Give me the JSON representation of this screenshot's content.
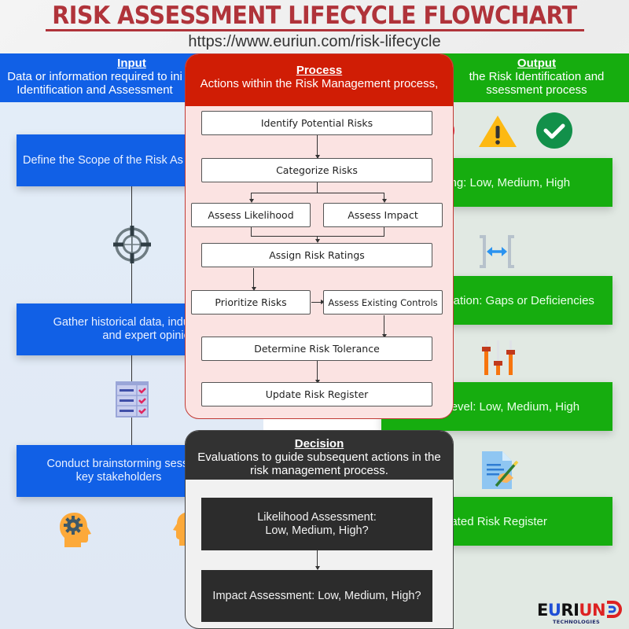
{
  "header": {
    "title": "RISK ASSESSMENT LIFECYCLE FLOWCHART",
    "url": "https://www.euriun.com/risk-lifecycle"
  },
  "input": {
    "heading": "Input",
    "description_line1": "Data or information required to ini",
    "description_line2": "Identification and Assessment",
    "steps": [
      {
        "line1": "Define the Scope of the Risk As",
        "line2": ""
      },
      {
        "line1": "Gather historical data, industr",
        "line2": "and expert opinions"
      },
      {
        "line1": "Conduct brainstorming sessi",
        "line2": "key stakeholders"
      }
    ],
    "icons": [
      "target-crosshair-icon",
      "checklist-icon",
      "head-gear-icon"
    ]
  },
  "process": {
    "heading": "Process",
    "description": "Actions within the Risk Management process,",
    "steps": {
      "identify": "Identify Potential Risks",
      "categorize": "Categorize Risks",
      "likelihood": "Assess Likelihood",
      "impact": "Assess Impact",
      "assign": "Assign Risk Ratings",
      "prioritize": "Prioritize Risks",
      "controls": "Assess Existing Controls",
      "tolerance": "Determine Risk Tolerance",
      "update": "Update Risk Register"
    }
  },
  "output": {
    "heading": "Output",
    "description_line1": "the Risk Identification and",
    "description_line2": "ssessment process",
    "results": [
      "ting: Low, Medium, High",
      "luation: Gaps or Deficiencies",
      "nce Level: Low, Medium, High",
      "dated Risk Register"
    ],
    "icons": [
      "warning-triangle-icon",
      "check-circle-icon",
      "width-arrows-icon",
      "sliders-icon",
      "document-sign-icon"
    ]
  },
  "decision": {
    "heading": "Decision",
    "description_line1": "Evaluations to guide subsequent actions in the",
    "description_line2": "risk management process.",
    "questions": [
      {
        "line1": "Likelihood Assessment:",
        "line2": "Low, Medium, High?"
      },
      {
        "line1": "Impact Assessment: Low, Medium, High?",
        "line2": ""
      }
    ]
  },
  "brand": {
    "name_part1": "E",
    "name_part2": "U",
    "name_part3": "RI",
    "name_part4": "UN",
    "tagline": "TECHNOLOGIES"
  },
  "colors": {
    "title": "#b0333a",
    "input": "#1160e6",
    "process": "#d01d05",
    "output": "#16ad0f",
    "decision": "#323232"
  }
}
